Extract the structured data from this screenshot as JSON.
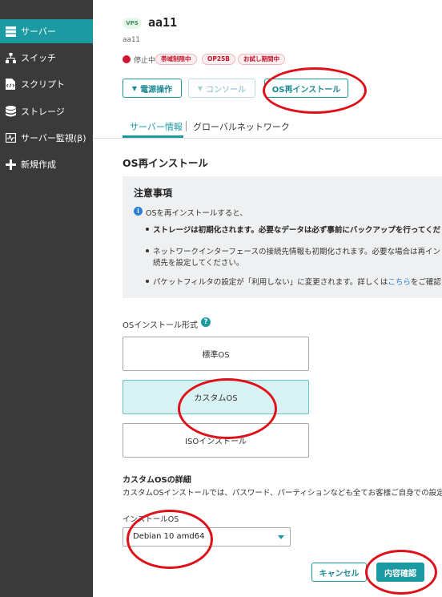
{
  "sidebar": {
    "items": [
      {
        "label": "サーバー",
        "icon": "server-icon",
        "active": true
      },
      {
        "label": "スイッチ",
        "icon": "switch-icon"
      },
      {
        "label": "スクリプト",
        "icon": "script-icon"
      },
      {
        "label": "ストレージ",
        "icon": "storage-icon"
      },
      {
        "label": "サーバー監視(β)",
        "icon": "monitor-icon"
      },
      {
        "label": "新規作成",
        "icon": "plus-icon"
      }
    ]
  },
  "server": {
    "badge": "VPS",
    "name": "aa11",
    "subname": "aa11",
    "status": "停止中",
    "tags": [
      "帯域制限中",
      "OP25B",
      "お試し期間中"
    ]
  },
  "actions": {
    "power": "電源操作",
    "console": "コンソール",
    "reinstall": "OS再インストール"
  },
  "tabs": [
    "サーバー情報",
    "グローバルネットワーク"
  ],
  "section_title": "OS再インストール",
  "notice": {
    "title": "注意事項",
    "intro": "OSを再インストールすると、",
    "bullet1": "ストレージは初期化されます。必要なデータは必ず事前にバックアップを行ってくだ",
    "bullet2_line1": "ネットワークインターフェースの接続先情報も初期化されます。必要な場合は再イン",
    "bullet2_line2": "続先を設定してください。",
    "bullet3_before": "パケットフィルタの設定が「利用しない」に変更されます。詳しくは",
    "bullet3_link": "こちら",
    "bullet3_after": "をご確認"
  },
  "install_type": {
    "label": "OSインストール形式",
    "options": [
      "標準OS",
      "カスタムOS",
      "ISOインストール"
    ],
    "selected": "カスタムOS"
  },
  "custom_detail": {
    "title": "カスタムOSの詳細",
    "text": "カスタムOSインストールでは、パスワード、パーティションなども全てお客様ご自身での設定"
  },
  "install_os": {
    "label": "インストールOS",
    "value": "Debian 10 amd64"
  },
  "footer": {
    "cancel": "キャンセル",
    "confirm": "内容確認"
  },
  "colors": {
    "accent": "#1b9aa2",
    "sidebar": "#3a3a3a",
    "annotation": "#e0101a"
  }
}
